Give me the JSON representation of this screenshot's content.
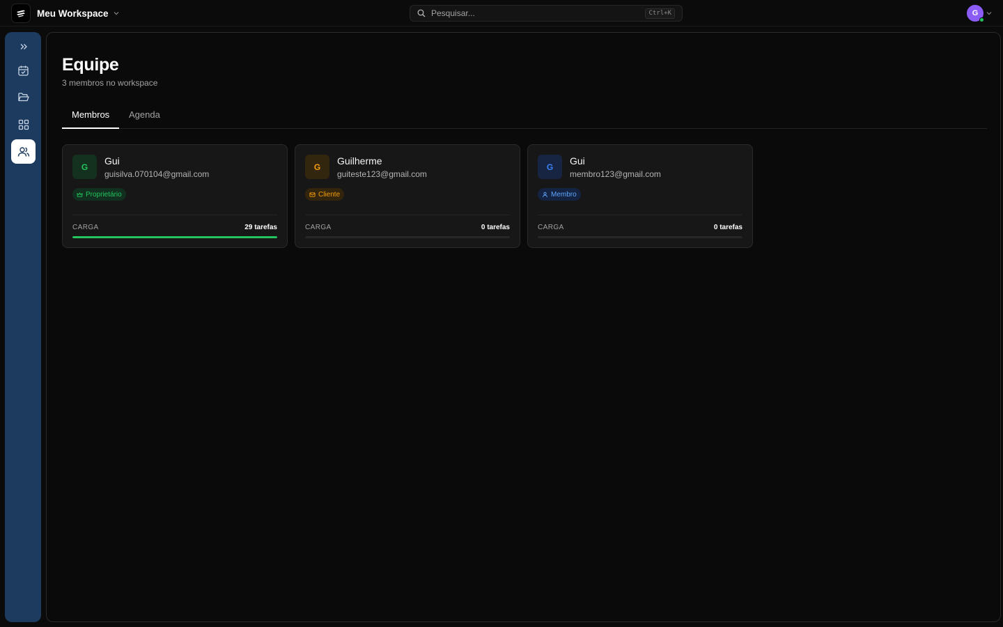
{
  "header": {
    "workspace_name": "Meu Workspace",
    "search_placeholder": "Pesquisar...",
    "search_shortcut": "Ctrl+K",
    "user_initial": "G",
    "avatar_color": "#8b5cf6"
  },
  "sidebar": {
    "items": [
      {
        "icon": "chevrons-right-icon",
        "active": false
      },
      {
        "icon": "calendar-check-icon",
        "active": false
      },
      {
        "icon": "folder-open-icon",
        "active": false
      },
      {
        "icon": "grid-icon",
        "active": false
      },
      {
        "icon": "users-icon",
        "active": true
      }
    ],
    "color": "#1d3a5f"
  },
  "page": {
    "title": "Equipe",
    "subtitle": "3 membros no workspace"
  },
  "tabs": [
    {
      "label": "Membros",
      "active": true
    },
    {
      "label": "Agenda",
      "active": false
    }
  ],
  "members": [
    {
      "initial": "G",
      "name": "Gui",
      "email": "guisilva.070104@gmail.com",
      "role": "Proprietário",
      "role_icon": "crown-icon",
      "role_color": "#22c55e",
      "load_label": "CARGA",
      "load_value": "29 tarefas",
      "load_fraction": 1.0
    },
    {
      "initial": "G",
      "name": "Guilherme",
      "email": "guiteste123@gmail.com",
      "role": "Cliente",
      "role_icon": "mail-icon",
      "role_color": "#f59e0b",
      "load_label": "CARGA",
      "load_value": "0 tarefas",
      "load_fraction": 0
    },
    {
      "initial": "G",
      "name": "Gui",
      "email": "membro123@gmail.com",
      "role": "Membro",
      "role_icon": "user-icon",
      "role_color": "#3b82f6",
      "load_label": "CARGA",
      "load_value": "0 tarefas",
      "load_fraction": 0
    }
  ]
}
